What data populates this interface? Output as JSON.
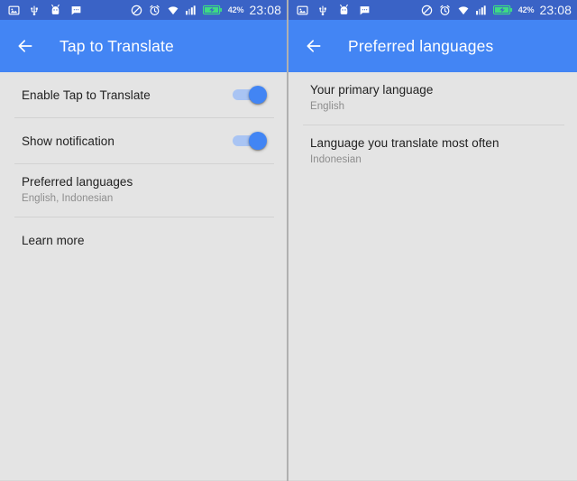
{
  "status_bar": {
    "background_color": "#3a63c6",
    "icons": [
      {
        "name": "image-icon",
        "glyph": "picture"
      },
      {
        "name": "usb-icon",
        "glyph": "usb"
      },
      {
        "name": "android-debug-icon",
        "glyph": "android"
      },
      {
        "name": "message-icon",
        "glyph": "chat-bubble"
      },
      {
        "name": "do-not-disturb-icon",
        "glyph": "no-entry"
      },
      {
        "name": "alarm-icon",
        "glyph": "alarm-clock"
      },
      {
        "name": "wifi-icon",
        "glyph": "wifi"
      },
      {
        "name": "cellular-signal-icon",
        "glyph": "signal-bars"
      }
    ],
    "battery_icon_name": "battery-charging-icon",
    "battery_color": "#3ddc84",
    "battery_percent": "42%",
    "clock": "23:08"
  },
  "left_panel": {
    "appbar": {
      "back_icon": "back-arrow-icon",
      "title": "Tap to Translate",
      "background_color": "#4385f4"
    },
    "rows": [
      {
        "type": "toggle",
        "title": "Enable Tap to Translate",
        "toggle_state": "on",
        "toggle_color": "#4285f4"
      },
      {
        "type": "toggle",
        "title": "Show notification",
        "toggle_state": "on",
        "toggle_color": "#4285f4"
      },
      {
        "type": "two-line",
        "title": "Preferred languages",
        "subtitle": "English, Indonesian"
      },
      {
        "type": "single",
        "title": "Learn more"
      }
    ]
  },
  "right_panel": {
    "appbar": {
      "back_icon": "back-arrow-icon",
      "title": "Preferred languages",
      "background_color": "#4385f4"
    },
    "rows": [
      {
        "type": "two-line",
        "title": "Your primary language",
        "subtitle": "English"
      },
      {
        "type": "two-line",
        "title": "Language you translate most often",
        "subtitle": "Indonesian"
      }
    ]
  }
}
